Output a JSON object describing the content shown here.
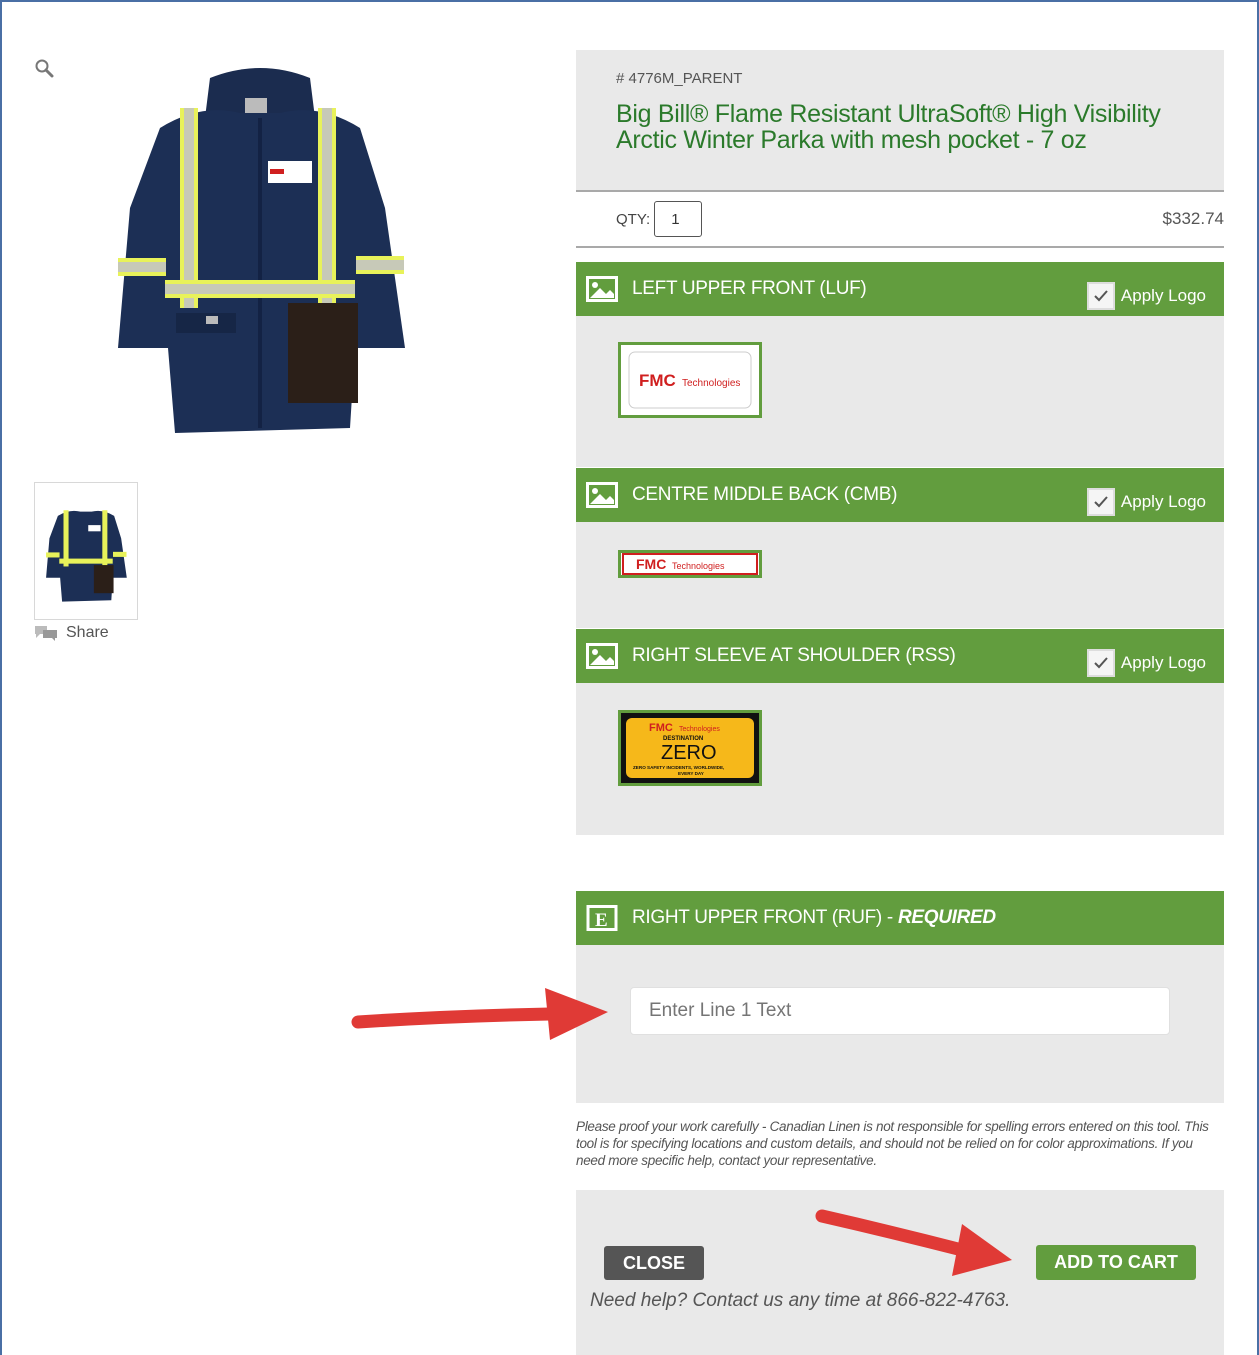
{
  "product": {
    "sku": "# 4776M_PARENT",
    "title": "Big Bill® Flame Resistant UltraSoft® High Visibility Arctic Winter Parka with mesh pocket - 7 oz",
    "qty_label": "QTY:",
    "qty_value": "1",
    "price": "$332.74"
  },
  "gallery": {
    "share_label": "Share",
    "zoom_icon": "magnifier-icon"
  },
  "locations": [
    {
      "title": "LEFT UPPER FRONT (LUF)",
      "apply_label": "Apply Logo",
      "checked": true
    },
    {
      "title": "CENTRE MIDDLE BACK (CMB)",
      "apply_label": "Apply Logo",
      "checked": true
    },
    {
      "title": "RIGHT SLEEVE AT SHOULDER (RSS)",
      "apply_label": "Apply Logo",
      "checked": true
    }
  ],
  "logos": {
    "fmc_brand": "FMC",
    "fmc_tech": "Technologies",
    "dz_destination": "DESTINATION",
    "dz_zero": "ZERO",
    "dz_tagline_1": "ZERO SAFETY INCIDENTS, WORLDWIDE,",
    "dz_tagline_2": "EVERY DAY"
  },
  "text_location": {
    "title": "RIGHT UPPER FRONT (RUF) - ",
    "required": "REQUIRED",
    "placeholder": "Enter Line 1 Text"
  },
  "disclaimer": "Please proof your work carefully - Canadian Linen is not responsible for spelling errors entered on this tool. This tool is for specifying locations and custom details, and should not be relied on for color approximations. If you need more specific help, contact your representative.",
  "actions": {
    "close_label": "CLOSE",
    "add_to_cart_label": "ADD TO CART",
    "help_text": "Need help? Contact us any time at 866-822-4763."
  },
  "colors": {
    "green": "#629d3e",
    "title_green": "#2b7a2b",
    "panel_gray": "#e9e9e9",
    "arrow_red": "#e03a36"
  }
}
